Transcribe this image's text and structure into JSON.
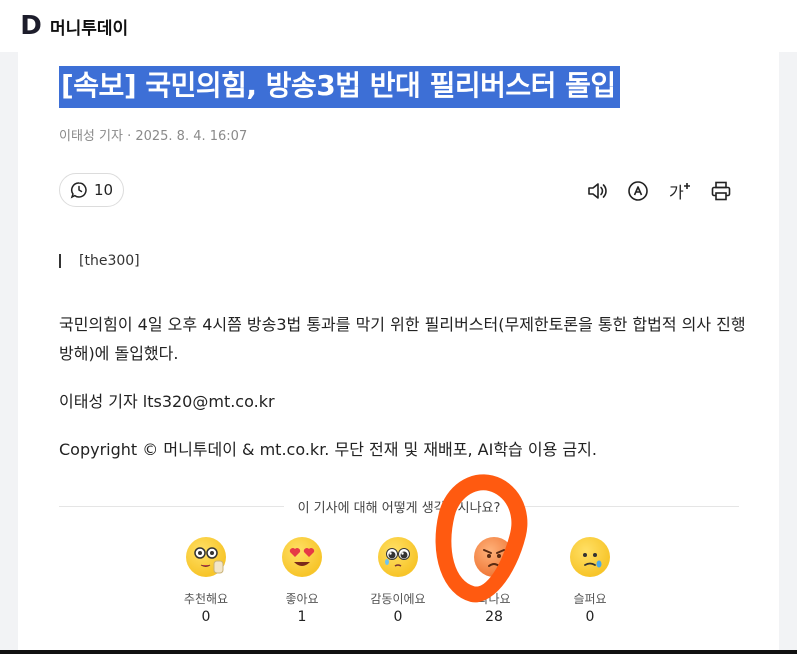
{
  "site": {
    "logo_letter": "D",
    "name": "머니투데이"
  },
  "article": {
    "headline": "[속보] 국민의힘, 방송3법 반대 필리버스터 돌입",
    "byline": "이태성 기자 · 2025. 8. 4. 16:07",
    "comment_count": "10",
    "tag": "[the300]",
    "body": "국민의힘이 4일 오후 4시쯤 방송3법 통과를 막기 위한 필리버스터(무제한토론을 통한 합법적 의사 진행 방해)에 돌입했다.",
    "reporter": "이태성 기자 lts320@mt.co.kr",
    "copyright": "Copyright © 머니투데이 & mt.co.kr. 무단 전재 및 재배포, AI학습 이용 금지."
  },
  "tools": {
    "icons": [
      "speaker-icon",
      "translate-icon",
      "font-size-icon",
      "print-icon"
    ]
  },
  "reactions": {
    "prompt": "이 기사에 대해 어떻게 생각하시나요?",
    "items": [
      {
        "label": "추천해요",
        "count": "0",
        "icon": "thinking-face-icon"
      },
      {
        "label": "좋아요",
        "count": "1",
        "icon": "heart-eyes-icon"
      },
      {
        "label": "감동이에요",
        "count": "0",
        "icon": "teary-eyes-icon"
      },
      {
        "label": "화나요",
        "count": "28",
        "icon": "angry-face-icon"
      },
      {
        "label": "슬퍼요",
        "count": "0",
        "icon": "sad-face-icon"
      }
    ]
  },
  "colors": {
    "highlight": "#3d6fd6",
    "annotation": "#ff5a10"
  }
}
